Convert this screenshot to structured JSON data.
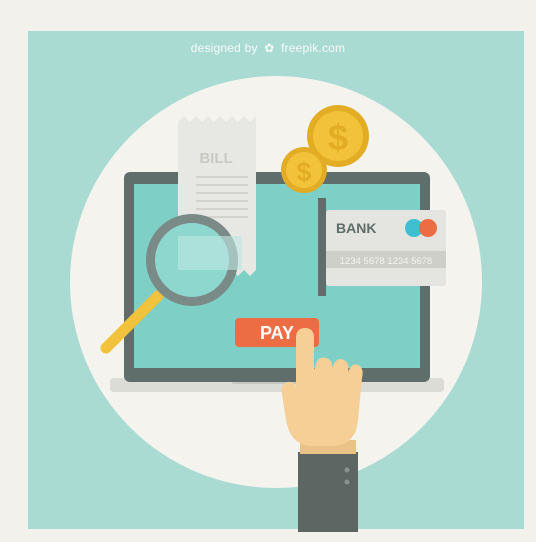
{
  "credit": {
    "prefix": "designed by",
    "brand": "freepik.com",
    "icon": "freepik-logo-icon"
  },
  "bill": {
    "title": "BILL",
    "icon": "receipt-icon"
  },
  "coins": {
    "symbol": "$",
    "icon": "dollar-coin-icon"
  },
  "card": {
    "bank_label": "BANK",
    "number": "1234 5678 1234 5678",
    "icon": "credit-card-icon"
  },
  "pay_button": {
    "label": "PAY"
  },
  "magnifier": {
    "icon": "magnifying-glass-icon"
  },
  "hand": {
    "icon": "pointing-hand-icon"
  },
  "colors": {
    "background": "#a9dbd3",
    "circle": "#f4f3ee",
    "screen": "#7ecfc6",
    "laptop_frame": "#5f6e6b",
    "pay": "#ec6c43",
    "coin": "#f2c33a",
    "card_accent_teal": "#3fbfd0",
    "card_accent_orange": "#ec6c43",
    "magnifier_handle": "#f1c23c",
    "sleeve": "#5e6664",
    "skin": "#f5cf95"
  }
}
